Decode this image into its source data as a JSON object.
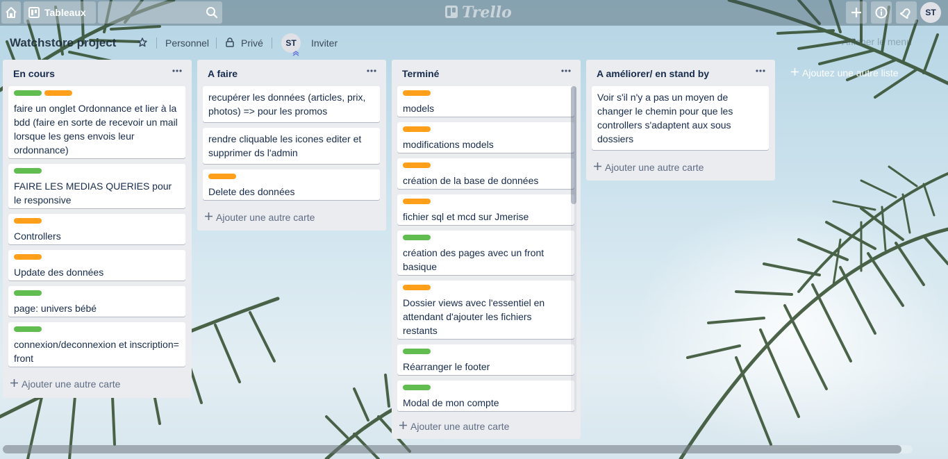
{
  "header": {
    "home_icon": "home-icon",
    "boards_label": "Tableaux",
    "search_placeholder": "",
    "logo_text": "Trello",
    "avatar_initials": "ST"
  },
  "board": {
    "title": "Watchstore project",
    "team": "Personnel",
    "visibility": "Privé",
    "member_initials": "ST",
    "invite_label": "Inviter",
    "menu_label": "Afficher le menu"
  },
  "lists": [
    {
      "title": "En cours",
      "add_card_label": "Ajouter une autre carte",
      "cards": [
        {
          "labels": [
            "#61bd4f",
            "#ff9f1a"
          ],
          "text": "faire un onglet Ordonnance et lier à la bdd (faire en sorte de recevoir un mail lorsque les gens envois leur ordonnance)"
        },
        {
          "labels": [
            "#61bd4f"
          ],
          "text": "FAIRE LES MEDIAS QUERIES pour le responsive"
        },
        {
          "labels": [
            "#ff9f1a"
          ],
          "text": "Controllers"
        },
        {
          "labels": [
            "#ff9f1a"
          ],
          "text": "Update des données"
        },
        {
          "labels": [
            "#61bd4f"
          ],
          "text": "page: univers bébé"
        },
        {
          "labels": [
            "#61bd4f"
          ],
          "text": "connexion/deconnexion et inscription= front"
        }
      ]
    },
    {
      "title": "A faire",
      "add_card_label": "Ajouter une autre carte",
      "cards": [
        {
          "labels": [],
          "text": "recupérer les données (articles, prix, photos) => pour les promos"
        },
        {
          "labels": [],
          "text": "rendre cliquable les icones editer et supprimer ds l'admin"
        },
        {
          "labels": [
            "#ff9f1a"
          ],
          "text": "Delete des données"
        }
      ]
    },
    {
      "title": "Terminé",
      "add_card_label": "Ajouter une autre carte",
      "cards": [
        {
          "labels": [
            "#ff9f1a"
          ],
          "text": "models"
        },
        {
          "labels": [
            "#ff9f1a"
          ],
          "text": "modifications models"
        },
        {
          "labels": [
            "#ff9f1a"
          ],
          "text": "création de la base de données"
        },
        {
          "labels": [
            "#ff9f1a"
          ],
          "text": "fichier sql et mcd sur Jmerise"
        },
        {
          "labels": [
            "#61bd4f"
          ],
          "text": "création des pages avec un front basique"
        },
        {
          "labels": [
            "#ff9f1a"
          ],
          "text": "Dossier views avec l'essentiel en attendant d'ajouter les fichiers restants"
        },
        {
          "labels": [
            "#61bd4f"
          ],
          "text": "Réarranger le footer"
        },
        {
          "labels": [
            "#61bd4f"
          ],
          "text": "Modal de mon compte"
        }
      ]
    },
    {
      "title": "A améliorer/ en stand by",
      "add_card_label": "Ajouter une autre carte",
      "cards": [
        {
          "labels": [],
          "text": "Voir s'il n'y a pas un moyen de changer le chemin pour que les controllers s'adaptent aux sous dossiers"
        }
      ]
    }
  ],
  "add_list_label": "Ajoutez une autre liste",
  "colors": {
    "label_green": "#61bd4f",
    "label_orange": "#ff9f1a",
    "list_bg": "#ebecf0"
  }
}
